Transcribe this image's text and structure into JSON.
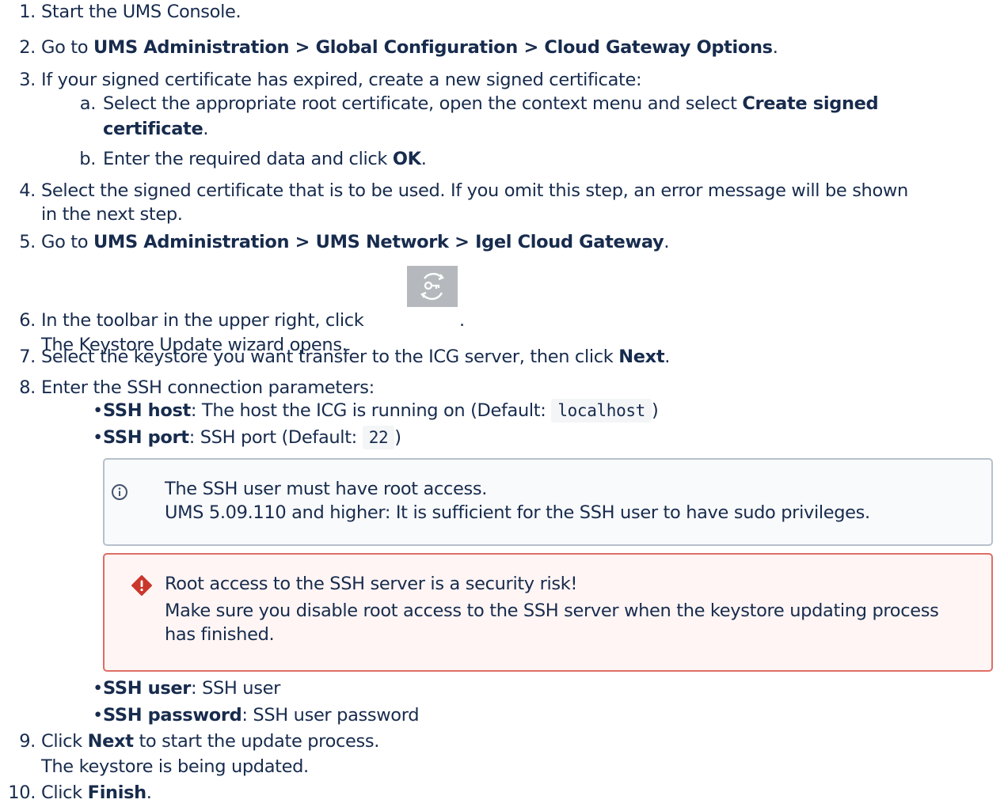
{
  "steps": {
    "s1": {
      "num": "1.",
      "text": "Start the UMS Console."
    },
    "s2": {
      "num": "2.",
      "pre": "Go to ",
      "bold": "UMS Administration > Global Configuration > Cloud Gateway Options",
      "post": "."
    },
    "s3": {
      "num": "3.",
      "text": "If your signed certificate has expired, create a new signed certificate:"
    },
    "s3a": {
      "num": "a.",
      "pre": "Select the appropriate root certificate, open the context menu and select ",
      "bold1": "Create signed",
      "bold2": "certificate",
      "post": "."
    },
    "s3b": {
      "num": "b.",
      "pre": "Enter the required data and click ",
      "bold": "OK",
      "post": "."
    },
    "s4": {
      "num": "4.",
      "line1": "Select the signed certificate that is to be used. If you omit this step, an error message will be shown",
      "line2": "in the next step."
    },
    "s5": {
      "num": "5.",
      "pre": "Go to ",
      "bold": "UMS Administration > UMS Network > Igel Cloud Gateway",
      "post": "."
    },
    "s6": {
      "num": "6.",
      "pre": "In the toolbar in the upper right, click",
      "post": ".",
      "line2": "The Keystore Update wizard opens."
    },
    "s7": {
      "num": "7.",
      "pre": "Select the keystore you want transfer to the ICG server, then click ",
      "bold": "Next",
      "post": "."
    },
    "s8": {
      "num": "8.",
      "text": "Enter the SSH connection parameters:"
    },
    "b_host": {
      "bold": "SSH host",
      "pre": ": The host the ICG is running on (Default: ",
      "code": "localhost",
      "post": ")"
    },
    "b_port": {
      "bold": "SSH port",
      "pre": ": SSH port (Default: ",
      "code": "22",
      "post": ")"
    },
    "info": {
      "line1": "The SSH user must have root access.",
      "line2": "UMS 5.09.110 and higher: It is sufficient for the SSH user to have sudo privileges."
    },
    "warn": {
      "line1": "Root access to the SSH server is a security risk!",
      "line2": "Make sure you disable root access to the SSH server when the keystore updating process",
      "line3": "has finished."
    },
    "b_user": {
      "bold": "SSH user",
      "post": ": SSH user"
    },
    "b_pass": {
      "bold": "SSH password",
      "post": ": SSH user password"
    },
    "s9": {
      "num": "9.",
      "pre": "Click ",
      "bold": "Next",
      "post": " to start the update process.",
      "line2": "The keystore is being updated."
    },
    "s10": {
      "num": "10.",
      "pre": "Click ",
      "bold": "Finish",
      "post": "."
    },
    "bullet": "•"
  },
  "icons": {
    "info": "info-circle-icon",
    "warn": "warning-diamond-icon",
    "toolbar": "keystore-update-icon"
  },
  "colors": {
    "text": "#172b4d",
    "info_border": "#b7c0cc",
    "warn_border": "#de6e66",
    "warn_icon": "#c9372c",
    "info_icon": "#44546f"
  }
}
